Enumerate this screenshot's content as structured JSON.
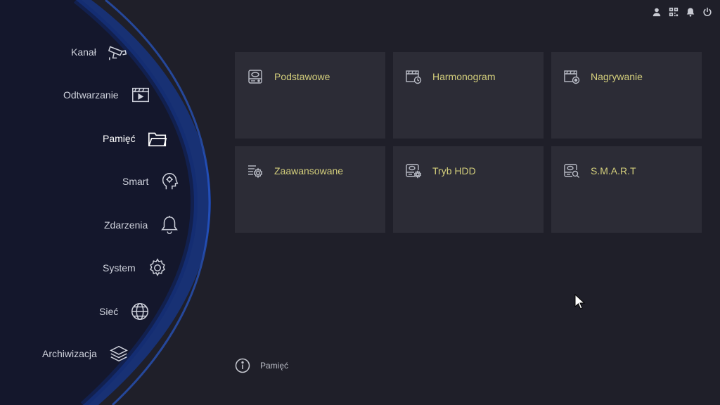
{
  "sidebar": {
    "items": [
      {
        "label": "Kanał",
        "icon": "camera-icon"
      },
      {
        "label": "Odtwarzanie",
        "icon": "playback-icon"
      },
      {
        "label": "Pamięć",
        "icon": "folder-icon",
        "active": true
      },
      {
        "label": "Smart",
        "icon": "head-icon"
      },
      {
        "label": "Zdarzenia",
        "icon": "bell-icon"
      },
      {
        "label": "System",
        "icon": "gear-icon"
      },
      {
        "label": "Sieć",
        "icon": "globe-icon"
      },
      {
        "label": "Archiwizacja",
        "icon": "layers-icon"
      }
    ]
  },
  "top_icons": [
    "user-icon",
    "qr-icon",
    "alarm-icon",
    "power-icon"
  ],
  "tiles": [
    {
      "label": "Podstawowe",
      "icon": "hdd-icon"
    },
    {
      "label": "Harmonogram",
      "icon": "schedule-icon"
    },
    {
      "label": "Nagrywanie",
      "icon": "record-icon"
    },
    {
      "label": "Zaawansowane",
      "icon": "advanced-icon"
    },
    {
      "label": "Tryb HDD",
      "icon": "hdd-mode-icon"
    },
    {
      "label": "S.M.A.R.T",
      "icon": "smart-icon"
    }
  ],
  "info": {
    "text": "Pamięć"
  },
  "colors": {
    "background": "#1f1f29",
    "tile": "#2c2c36",
    "tile_label": "#d4cf7c",
    "accent_blue": "#1f4fb8"
  }
}
